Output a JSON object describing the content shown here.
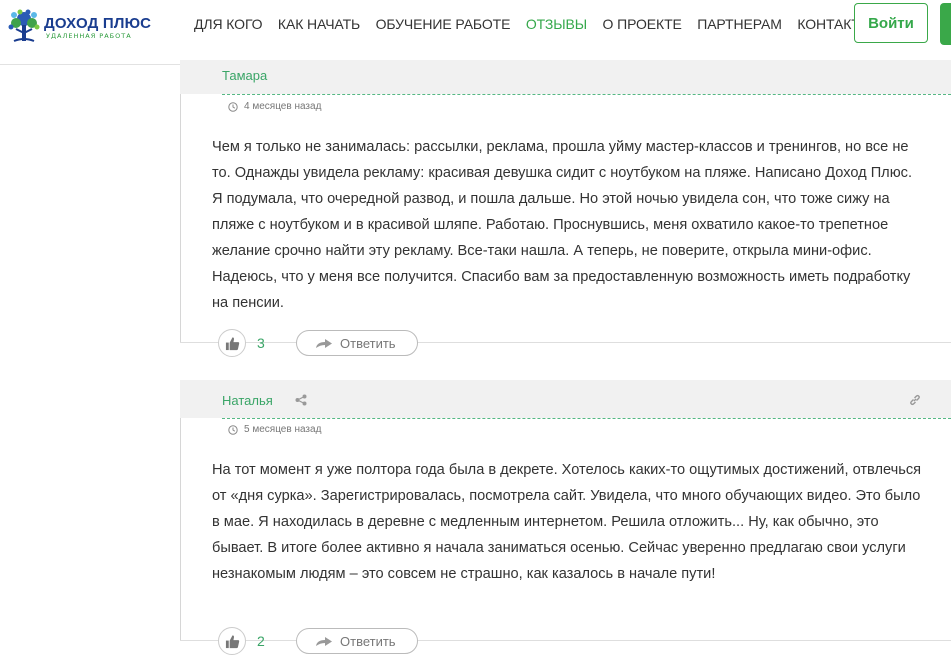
{
  "header": {
    "logo": {
      "title": "ДОХОД ПЛЮС",
      "subtitle": "УДАЛЕННАЯ РАБОТА"
    },
    "nav": [
      {
        "label": "ДЛЯ КОГО",
        "active": false
      },
      {
        "label": "КАК НАЧАТЬ",
        "active": false
      },
      {
        "label": "ОБУЧЕНИЕ РАБОТЕ",
        "active": false
      },
      {
        "label": "ОТЗЫВЫ",
        "active": true
      },
      {
        "label": "О ПРОЕКТЕ",
        "active": false
      },
      {
        "label": "ПАРТНЕРАМ",
        "active": false
      },
      {
        "label": "КОНТАКТЫ",
        "active": false
      }
    ],
    "login_label": "Войти"
  },
  "comments": [
    {
      "author": "Тамара",
      "time": "4 месяцев назад",
      "text": "Чем я только не занималась: рассылки, реклама, прошла уйму мастер-классов и тренингов, но все не то. Однажды увидела рекламу: красивая девушка сидит с ноутбуком на пляже. Написано Доход Плюс. Я подумала, что очередной развод, и пошла дальше. Но этой ночью увидела сон, что тоже сижу на пляже с ноутбуком и в красивой шляпе. Работаю. Проснувшись, меня охватило какое-то трепетное желание срочно найти эту рекламу. Все-таки нашла. А теперь, не поверите, открыла мини-офис. Надеюсь, что у меня все получится. Спасибо вам за предоставленную возможность иметь подработку на пенсии.",
      "likes": "3",
      "reply_label": "Ответить"
    },
    {
      "author": "Наталья",
      "time": "5 месяцев назад",
      "text": "На тот момент я уже полтора года была в декрете. Хотелось каких-то ощутимых достижений, отвлечься от «дня сурка». Зарегистрировалась, посмотрела сайт. Увидела, что много обучающих видео. Это было в мае. Я находилась в деревне с медленным интернетом. Решила отложить... Ну, как обычно, это бывает. В итоге более активно я начала заниматься осенью. Сейчас уверенно предлагаю свои услуги незнакомым людям – это совсем не страшно, как казалось в начале пути!",
      "likes": "2",
      "reply_label": "Ответить"
    }
  ],
  "colors": {
    "accent": "#35a84b",
    "author": "#3aa567",
    "logo_blue": "#1a3d8f"
  },
  "icons": [
    "logo-tree-icon",
    "clock-icon",
    "thumbs-up-icon",
    "reply-arrow-icon",
    "share-icon",
    "link-icon"
  ]
}
